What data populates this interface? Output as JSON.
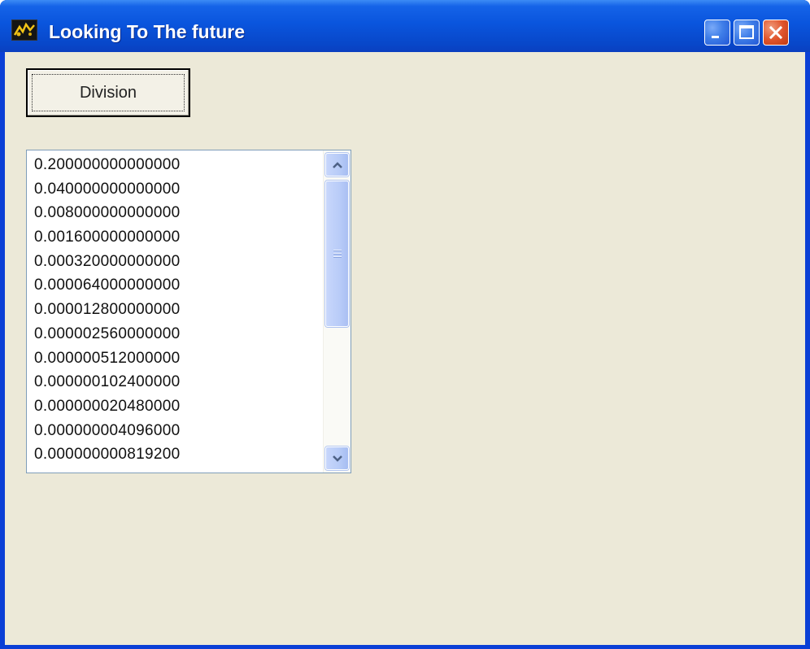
{
  "window": {
    "title": "Looking To The future",
    "app_icon": "app-icon",
    "controls": [
      "minimize-icon",
      "maximize-icon",
      "close-icon"
    ]
  },
  "toolbar": {
    "division_label": "Division"
  },
  "list": {
    "items": [
      "0.200000000000000",
      "0.040000000000000",
      "0.008000000000000",
      "0.001600000000000",
      "0.000320000000000",
      "0.000064000000000",
      "0.000012800000000",
      "0.000002560000000",
      "0.000000512000000",
      "0.000000102400000",
      "0.000000020480000",
      "0.000000004096000",
      "0.000000000819200"
    ]
  },
  "colors": {
    "titlebar": "#0a55dd",
    "client_bg": "#ece9d8",
    "close_button": "#e0552d",
    "list_border": "#7f9db9"
  }
}
